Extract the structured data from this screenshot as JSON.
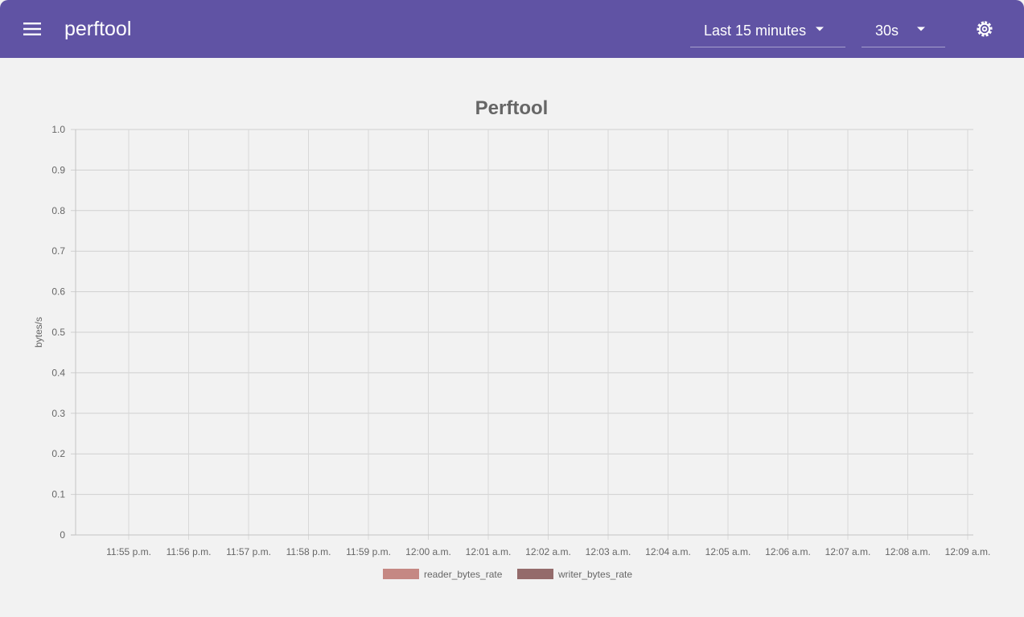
{
  "app": {
    "title": "perftool",
    "menu_icon": "menu-icon",
    "settings_icon": "gear-icon",
    "accent_color": "#6053a4"
  },
  "toolbar": {
    "time_range": "Last 15 minutes",
    "refresh_interval": "30s"
  },
  "chart_data": {
    "type": "bar",
    "title": "Perftool",
    "ylabel": "bytes/s",
    "xlabel": "",
    "ylim": [
      0,
      1
    ],
    "y_ticks": [
      "0",
      "0.1",
      "0.2",
      "0.3",
      "0.4",
      "0.5",
      "0.6",
      "0.7",
      "0.8",
      "0.9",
      "1.0"
    ],
    "x_ticks": [
      "11:55 p.m.",
      "11:56 p.m.",
      "11:57 p.m.",
      "11:58 p.m.",
      "11:59 p.m.",
      "12:00 a.m.",
      "12:01 a.m.",
      "12:02 a.m.",
      "12:03 a.m.",
      "12:04 a.m.",
      "12:05 a.m.",
      "12:06 a.m.",
      "12:07 a.m.",
      "12:08 a.m.",
      "12:09 a.m."
    ],
    "grid": true,
    "legend_position": "bottom",
    "series": [
      {
        "name": "reader_bytes_rate",
        "color": "#c58883",
        "values": []
      },
      {
        "name": "writer_bytes_rate",
        "color": "#946b6b",
        "values": []
      }
    ]
  }
}
